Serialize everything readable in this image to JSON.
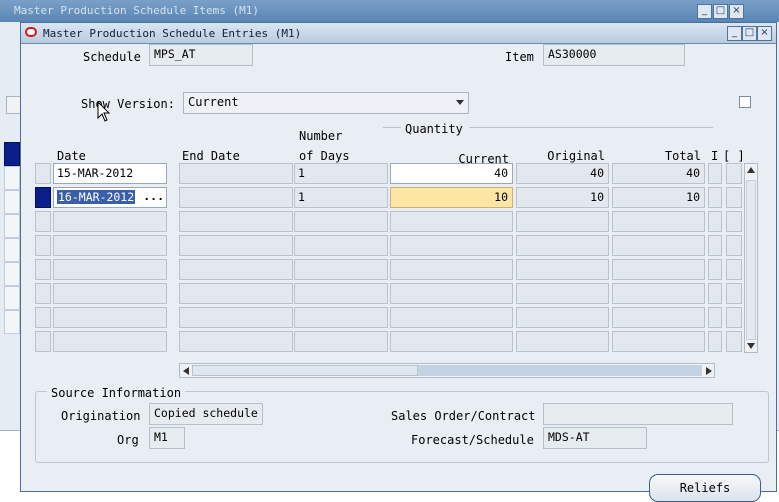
{
  "background_window": {
    "title": "Master Production Schedule Items (M1)"
  },
  "window": {
    "title": "Master Production Schedule Entries (M1)",
    "minimize": "_",
    "maximize": "□",
    "close": "×"
  },
  "header": {
    "schedule_label": "Schedule",
    "schedule_value": "MPS_AT",
    "item_label": "Item",
    "item_value": "AS30000",
    "show_version_label": "Show Version:",
    "show_version_value": "Current"
  },
  "grid": {
    "quantity_group": "Quantity",
    "headers": {
      "date": "Date",
      "end_date": "End Date",
      "number_of_days_1": "Number",
      "number_of_days_2": "of Days",
      "current": "Current",
      "original": "Original",
      "total": "Total",
      "extra": "I",
      "folder": "[ ]"
    },
    "rows": [
      {
        "date": "15-MAR-2012",
        "end_date": "",
        "days": "1",
        "current": "40",
        "original": "40",
        "total": "40"
      },
      {
        "date": "16-MAR-2012",
        "end_date": "",
        "days": "1",
        "current": "10",
        "original": "10",
        "total": "10",
        "lov": "..."
      },
      {
        "date": "",
        "end_date": "",
        "days": "",
        "current": "",
        "original": "",
        "total": ""
      },
      {
        "date": "",
        "end_date": "",
        "days": "",
        "current": "",
        "original": "",
        "total": ""
      },
      {
        "date": "",
        "end_date": "",
        "days": "",
        "current": "",
        "original": "",
        "total": ""
      },
      {
        "date": "",
        "end_date": "",
        "days": "",
        "current": "",
        "original": "",
        "total": ""
      },
      {
        "date": "",
        "end_date": "",
        "days": "",
        "current": "",
        "original": "",
        "total": ""
      },
      {
        "date": "",
        "end_date": "",
        "days": "",
        "current": "",
        "original": "",
        "total": ""
      }
    ]
  },
  "source": {
    "group_label": "Source Information",
    "origination_label": "Origination",
    "origination_value": "Copied schedule",
    "org_label": "Org",
    "org_value": "M1",
    "sales_order_label": "Sales Order/Contract",
    "sales_order_value": "",
    "forecast_label": "Forecast/Schedule",
    "forecast_value": "MDS-AT"
  },
  "buttons": {
    "reliefs": "Reliefs"
  }
}
